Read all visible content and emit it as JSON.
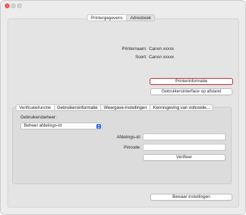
{
  "window": {
    "controls": [
      "close",
      "minimize",
      "maximize"
    ]
  },
  "top_tabs": [
    {
      "label": "Printergegevens",
      "active": true
    },
    {
      "label": "Adresboek",
      "active": false
    }
  ],
  "printer_info": {
    "name_label": "Printernaam:",
    "name_value": "Canon xxxxx",
    "type_label": "Soort:",
    "type_value": "Canon xxxxx"
  },
  "buttons": {
    "printer_info": "Printerinformatie",
    "remote_ui": "Gebruikersinterface op afstand",
    "verify": "Verifieer",
    "save_settings": "Bewaar instellingen"
  },
  "sub_tabs": [
    {
      "label": "Verificatiefunctie",
      "active": true
    },
    {
      "label": "Gebruikersinformatie",
      "active": false
    },
    {
      "label": "Weergave-instellingen",
      "active": false
    },
    {
      "label": "Kennisgeving van voltooide...",
      "active": false
    }
  ],
  "verification": {
    "user_mgmt_label": "Gebruikersbeheer:",
    "user_mgmt_selected": "Beheer afdelings-id",
    "dept_id_label": "Afdelings-id:",
    "dept_id_value": "",
    "pin_label": "Pincode:",
    "pin_value": ""
  },
  "colors": {
    "focus_ring": "#c12027",
    "select_accent": "#2f6fe4",
    "close_light": "#fe5f57"
  }
}
